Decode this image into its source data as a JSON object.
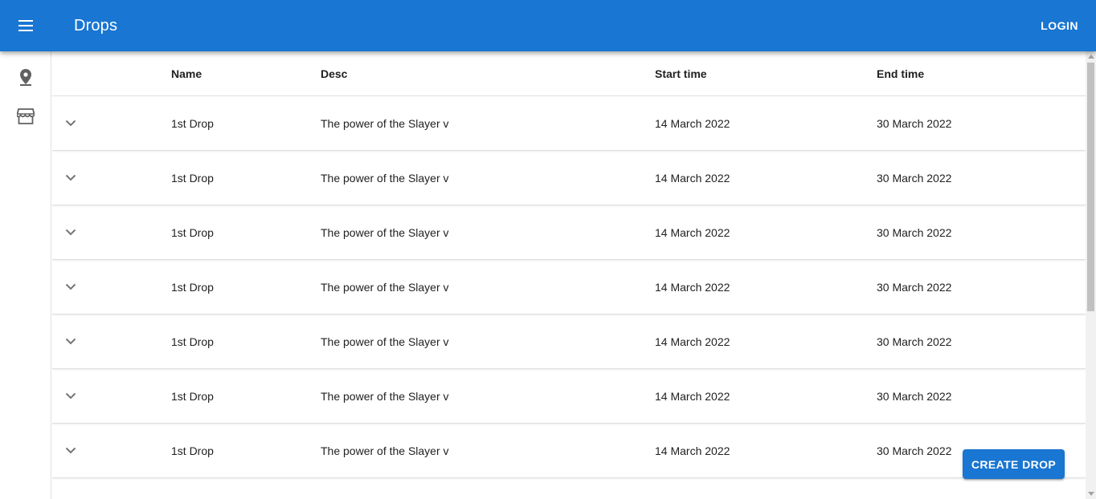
{
  "app": {
    "title": "Drops",
    "menu_icon": "menu-icon",
    "login_label": "LOGIN",
    "accent_color": "#1976d2"
  },
  "sidebar": {
    "items": [
      {
        "icon": "location-pin-icon",
        "name": "sidebar-item-map"
      },
      {
        "icon": "store-icon",
        "name": "sidebar-item-store"
      }
    ]
  },
  "table": {
    "columns": [
      "Name",
      "Desc",
      "Start time",
      "End time"
    ],
    "rows": [
      {
        "name": "1st Drop",
        "desc": "The power of the Slayer v",
        "start": "14 March 2022",
        "end": "30 March 2022"
      },
      {
        "name": "1st Drop",
        "desc": "The power of the Slayer v",
        "start": "14 March 2022",
        "end": "30 March 2022"
      },
      {
        "name": "1st Drop",
        "desc": "The power of the Slayer v",
        "start": "14 March 2022",
        "end": "30 March 2022"
      },
      {
        "name": "1st Drop",
        "desc": "The power of the Slayer v",
        "start": "14 March 2022",
        "end": "30 March 2022"
      },
      {
        "name": "1st Drop",
        "desc": "The power of the Slayer v",
        "start": "14 March 2022",
        "end": "30 March 2022"
      },
      {
        "name": "1st Drop",
        "desc": "The power of the Slayer v",
        "start": "14 March 2022",
        "end": "30 March 2022"
      },
      {
        "name": "1st Drop",
        "desc": "The power of the Slayer v",
        "start": "14 March 2022",
        "end": "30 March 2022"
      }
    ]
  },
  "actions": {
    "create_label": "CREATE DROP"
  }
}
